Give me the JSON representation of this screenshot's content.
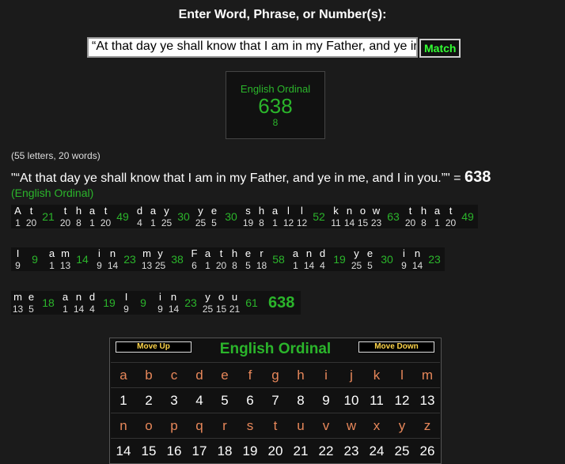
{
  "heading": "Enter Word, Phrase, or Number(s):",
  "input_value": "“At that day ye shall know that I am in my Father, and ye in me, and I in you.”",
  "match_label": "Match",
  "cipher_box": {
    "name": "English Ordinal",
    "value": "638",
    "reduced": "8"
  },
  "counts": "(55 letters, 20 words)",
  "phrase_display": "\"“At that day ye shall know that I am in my Father, and ye in me, and I in you.”\" = ",
  "phrase_total": "638",
  "cipher_label": "(English Ordinal)",
  "rows": [
    [
      {
        "letters": [
          [
            "A",
            "1"
          ],
          [
            "t",
            "20"
          ]
        ],
        "sum": "21"
      },
      {
        "letters": [
          [
            "t",
            "20"
          ],
          [
            "h",
            "8"
          ],
          [
            "a",
            "1"
          ],
          [
            "t",
            "20"
          ]
        ],
        "sum": "49"
      },
      {
        "letters": [
          [
            "d",
            "4"
          ],
          [
            "a",
            "1"
          ],
          [
            "y",
            "25"
          ]
        ],
        "sum": "30"
      },
      {
        "letters": [
          [
            "y",
            "25"
          ],
          [
            "e",
            "5"
          ]
        ],
        "sum": "30"
      },
      {
        "letters": [
          [
            "s",
            "19"
          ],
          [
            "h",
            "8"
          ],
          [
            "a",
            "1"
          ],
          [
            "l",
            "12"
          ],
          [
            "l",
            "12"
          ]
        ],
        "sum": "52"
      },
      {
        "letters": [
          [
            "k",
            "11"
          ],
          [
            "n",
            "14"
          ],
          [
            "o",
            "15"
          ],
          [
            "w",
            "23"
          ]
        ],
        "sum": "63"
      },
      {
        "letters": [
          [
            "t",
            "20"
          ],
          [
            "h",
            "8"
          ],
          [
            "a",
            "1"
          ],
          [
            "t",
            "20"
          ]
        ],
        "sum": "49"
      }
    ],
    [
      {
        "letters": [
          [
            "I",
            "9"
          ]
        ],
        "sum": "9"
      },
      {
        "letters": [
          [
            "a",
            "1"
          ],
          [
            "m",
            "13"
          ]
        ],
        "sum": "14"
      },
      {
        "letters": [
          [
            "i",
            "9"
          ],
          [
            "n",
            "14"
          ]
        ],
        "sum": "23"
      },
      {
        "letters": [
          [
            "m",
            "13"
          ],
          [
            "y",
            "25"
          ]
        ],
        "sum": "38"
      },
      {
        "letters": [
          [
            "F",
            "6"
          ],
          [
            "a",
            "1"
          ],
          [
            "t",
            "20"
          ],
          [
            "h",
            "8"
          ],
          [
            "e",
            "5"
          ],
          [
            "r",
            "18"
          ]
        ],
        "sum": "58"
      },
      {
        "letters": [
          [
            "a",
            "1"
          ],
          [
            "n",
            "14"
          ],
          [
            "d",
            "4"
          ]
        ],
        "sum": "19"
      },
      {
        "letters": [
          [
            "y",
            "25"
          ],
          [
            "e",
            "5"
          ]
        ],
        "sum": "30"
      },
      {
        "letters": [
          [
            "i",
            "9"
          ],
          [
            "n",
            "14"
          ]
        ],
        "sum": "23"
      }
    ],
    [
      {
        "letters": [
          [
            "m",
            "13"
          ],
          [
            "e",
            "5"
          ]
        ],
        "sum": "18"
      },
      {
        "letters": [
          [
            "a",
            "1"
          ],
          [
            "n",
            "14"
          ],
          [
            "d",
            "4"
          ]
        ],
        "sum": "19"
      },
      {
        "letters": [
          [
            "I",
            "9"
          ]
        ],
        "sum": "9"
      },
      {
        "letters": [
          [
            "i",
            "9"
          ],
          [
            "n",
            "14"
          ]
        ],
        "sum": "23"
      },
      {
        "letters": [
          [
            "y",
            "25"
          ],
          [
            "o",
            "15"
          ],
          [
            "u",
            "21"
          ]
        ],
        "sum": "61"
      }
    ]
  ],
  "grand_total": "638",
  "table": {
    "title": "English Ordinal",
    "move_up": "Move Up",
    "move_down": "Move Down",
    "letters1": [
      "a",
      "b",
      "c",
      "d",
      "e",
      "f",
      "g",
      "h",
      "i",
      "j",
      "k",
      "l",
      "m"
    ],
    "values1": [
      "1",
      "2",
      "3",
      "4",
      "5",
      "6",
      "7",
      "8",
      "9",
      "10",
      "11",
      "12",
      "13"
    ],
    "letters2": [
      "n",
      "o",
      "p",
      "q",
      "r",
      "s",
      "t",
      "u",
      "v",
      "w",
      "x",
      "y",
      "z"
    ],
    "values2": [
      "14",
      "15",
      "16",
      "17",
      "18",
      "19",
      "20",
      "21",
      "22",
      "23",
      "24",
      "25",
      "26"
    ]
  }
}
